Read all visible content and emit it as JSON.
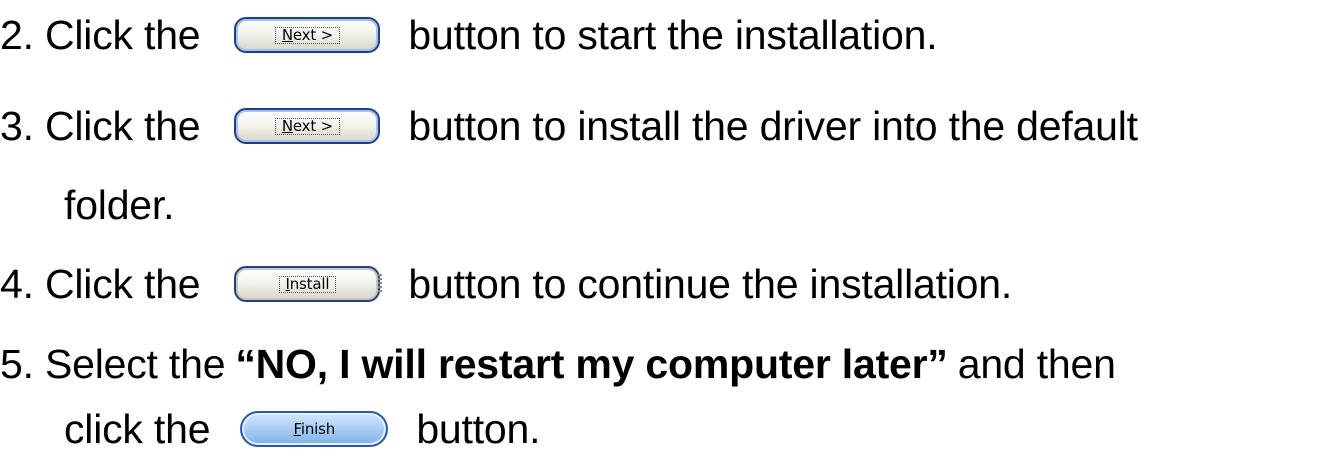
{
  "steps": [
    {
      "prefix": "2. Click the",
      "button": "Next >",
      "button_mnemonic": "N",
      "button_rest": "ext >",
      "suffix": "button to start the installation."
    },
    {
      "prefix": "3. Click the",
      "button": "Next >",
      "button_mnemonic": "N",
      "button_rest": "ext >",
      "suffix": "button to install the driver into the default",
      "continuation": "folder."
    },
    {
      "prefix": "4. Click the",
      "button": "Install",
      "button_mnemonic": "I",
      "button_rest": "nstall",
      "suffix": "button to continue the installation."
    },
    {
      "prefix": "5. Select the",
      "emphasis": "“NO, I will restart my computer later”",
      "suffix": "and then",
      "continuation_prefix": "click the",
      "button": "Finish",
      "button_mnemonic": "F",
      "button_rest": "inish",
      "continuation_suffix": "button."
    }
  ]
}
